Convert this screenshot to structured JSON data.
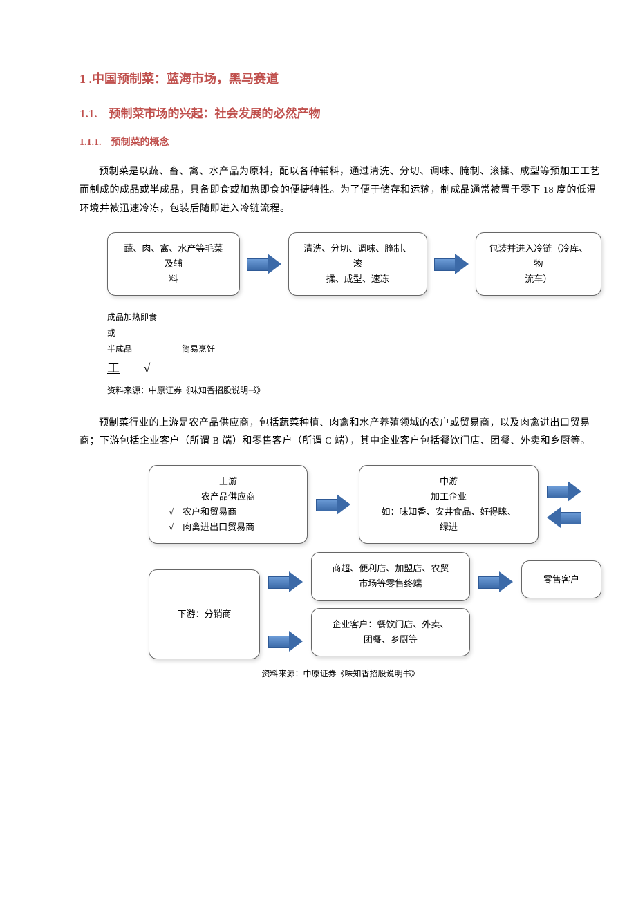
{
  "headings": {
    "h1": "1 .中国预制菜：蓝海市场，黑马赛道",
    "h2": "1.1.　预制菜市场的兴起：社会发展的必然产物",
    "h3": "1.1.1.　预制菜的概念"
  },
  "paragraphs": {
    "p1": "预制菜是以蔬、畜、禽、水产品为原料，配以各种辅料，通过清洗、分切、调味、腌制、滚揉、成型等预加工工艺而制成的成品或半成品，具备即食或加热即食的便捷特性。为了便于储存和运输，制成品通常被置于零下 18 度的低温环境并被迅速冷冻，包装后随即进入冷链流程。",
    "p2": "预制菜行业的上游是农产品供应商，包括蔬菜种植、肉禽和水产养殖领域的农户或贸易商，以及肉禽进出口贸易商；下游包括企业客户（所谓 B 端）和零售客户（所谓 C 端），其中企业客户包括餐饮门店、团餐、外卖和乡厨等。"
  },
  "flow1": {
    "box1_l1": "蔬、肉、禽、水产等毛菜",
    "box1_l2": "及辅",
    "box1_l3": "料",
    "box2_l1": "清洗、分切、调味、腌制、滚",
    "box2_l2": "揉、成型、速冻",
    "box3_l1": "包装并进入冷链（冷库、物",
    "box3_l2": "流车）"
  },
  "subtext": {
    "l1": "成品加热即食",
    "l2": "或",
    "l3": "半成品——————简易烹饪",
    "sym": "工　　√"
  },
  "source1": "资料来源：中原证券《味知香招股说明书》",
  "source2": "资料来源：中原证券《味知香招股说明书》",
  "flow2": {
    "upstream_title": "上游",
    "upstream_sub": "农产品供应商",
    "upstream_i1": "√　农户和贸易商",
    "upstream_i2": "√　肉禽进出口贸易商",
    "mid_title": "中游",
    "mid_sub": "加工企业",
    "mid_l1": "如：味知香、安井食品、好得睐、",
    "mid_l2": "绿进",
    "downstream": "下游：分销商",
    "retail_l1": "商超、便利店、加盟店、农贸",
    "retail_l2": "市场等零售终端",
    "retail_customer": "零售客户",
    "biz_l1": "企业客户：餐饮门店、外卖、",
    "biz_l2": "团餐、乡厨等"
  }
}
